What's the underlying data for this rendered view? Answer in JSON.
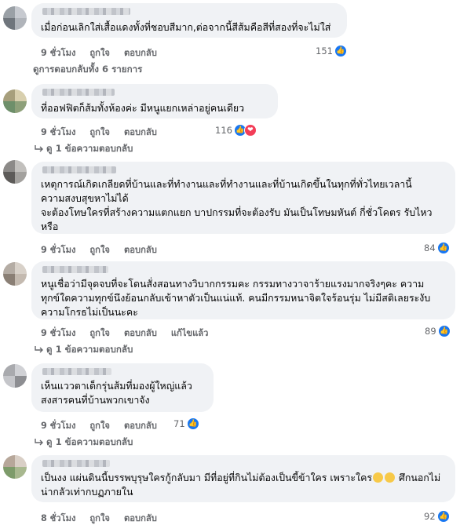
{
  "labels": {
    "like": "ถูกใจ",
    "reply": "ตอบกลับ",
    "edited": "แก้ไขแล้ว"
  },
  "colors": {
    "like": "#1877f2",
    "love": "#f33e58",
    "bubble": "#f0f2f5",
    "meta": "#65676b"
  },
  "comments": [
    {
      "text": "เมื่อก่อนเลิกใส่เสื้อแดงทั้งที่ชอบสีมาก,ต่อจากนี้สีส้มคือสีที่สองที่จะไม่ใส่",
      "time": "9 ชั่วโมง",
      "reactions": "151",
      "reaction_icons": [
        "like-icon"
      ],
      "replies_label": "ดูการตอบกลับทั้ง 6 รายการ"
    },
    {
      "text": "ที่ออฟฟิตก็ส้มทั้งห้องค่ะ มีหนูแยกเหล่าอยู่คนเดียว",
      "time": "9 ชั่วโมง",
      "reactions": "116",
      "reaction_icons": [
        "like-icon",
        "love-icon"
      ],
      "replies_label": "ดู 1 ข้อความตอบกลับ"
    },
    {
      "text": "เหตุการณ์เกิดเกลียดที่บ้านและที่ทำงานและที่ทำงานและที่บ้านเกิดขึ้นในทุกที่ทั่วไทยเวลานี้\nความสงบสุขหาไม่ได้\nจะต้องโทษใครที่สร้างความแตกแยก บาปกรรมที่จะต้องรับ มันเป็นโทษมหันต์ กี่ชั่วโคตร รับไหวหรือ",
      "time": "9 ชั่วโมง",
      "reactions": "84",
      "reaction_icons": [
        "like-icon"
      ]
    },
    {
      "text": "หนูเชื่อว่ามีจุดจบที่จะโดนสั่งสอนทางวิบากกรรมคะ กรรมทางวาจาร้ายแรงมากจริงๆคะ ความทุกข์ใดความทุกข์นึงย้อนกลับเข้าหาตัวเป็นแน่แท้. คนมีกรรมหนาจิตใจร้อนรุ่ม ไม่มีสติเลยระงับ ความโกรธไม่เป็นนะคะ",
      "time": "9 ชั่วโมง",
      "edited": true,
      "reactions": "89",
      "reaction_icons": [
        "like-icon"
      ],
      "replies_label": "ดู 1 ข้อความตอบกลับ"
    },
    {
      "text": "เห็นแววตาเด็กรุ่นส้มที่มองผู้ใหญ่แล้ว\nสงสารคนที่บ้านพวกเขาจัง",
      "time": "9 ชั่วโมง",
      "reactions": "71",
      "reaction_icons": [
        "like-icon"
      ],
      "replies_label": "ดู 1 ข้อความตอบกลับ"
    },
    {
      "text_before": "เป็นงง แผ่นดินนี้บรรพบุรุษใครกู้กลับมา มีที่อยู่ที่กินไม่ต้องเป็นขี้ข้าใคร เพราะใคร",
      "text_after": " ศึกนอกไม่น่ากลัวเท่ากบฏภายใน",
      "emoji": [
        "confused-face-icon",
        "confused-face-icon"
      ],
      "time": "8 ชั่วโมง",
      "reactions": "92",
      "reaction_icons": [
        "like-icon"
      ]
    }
  ]
}
